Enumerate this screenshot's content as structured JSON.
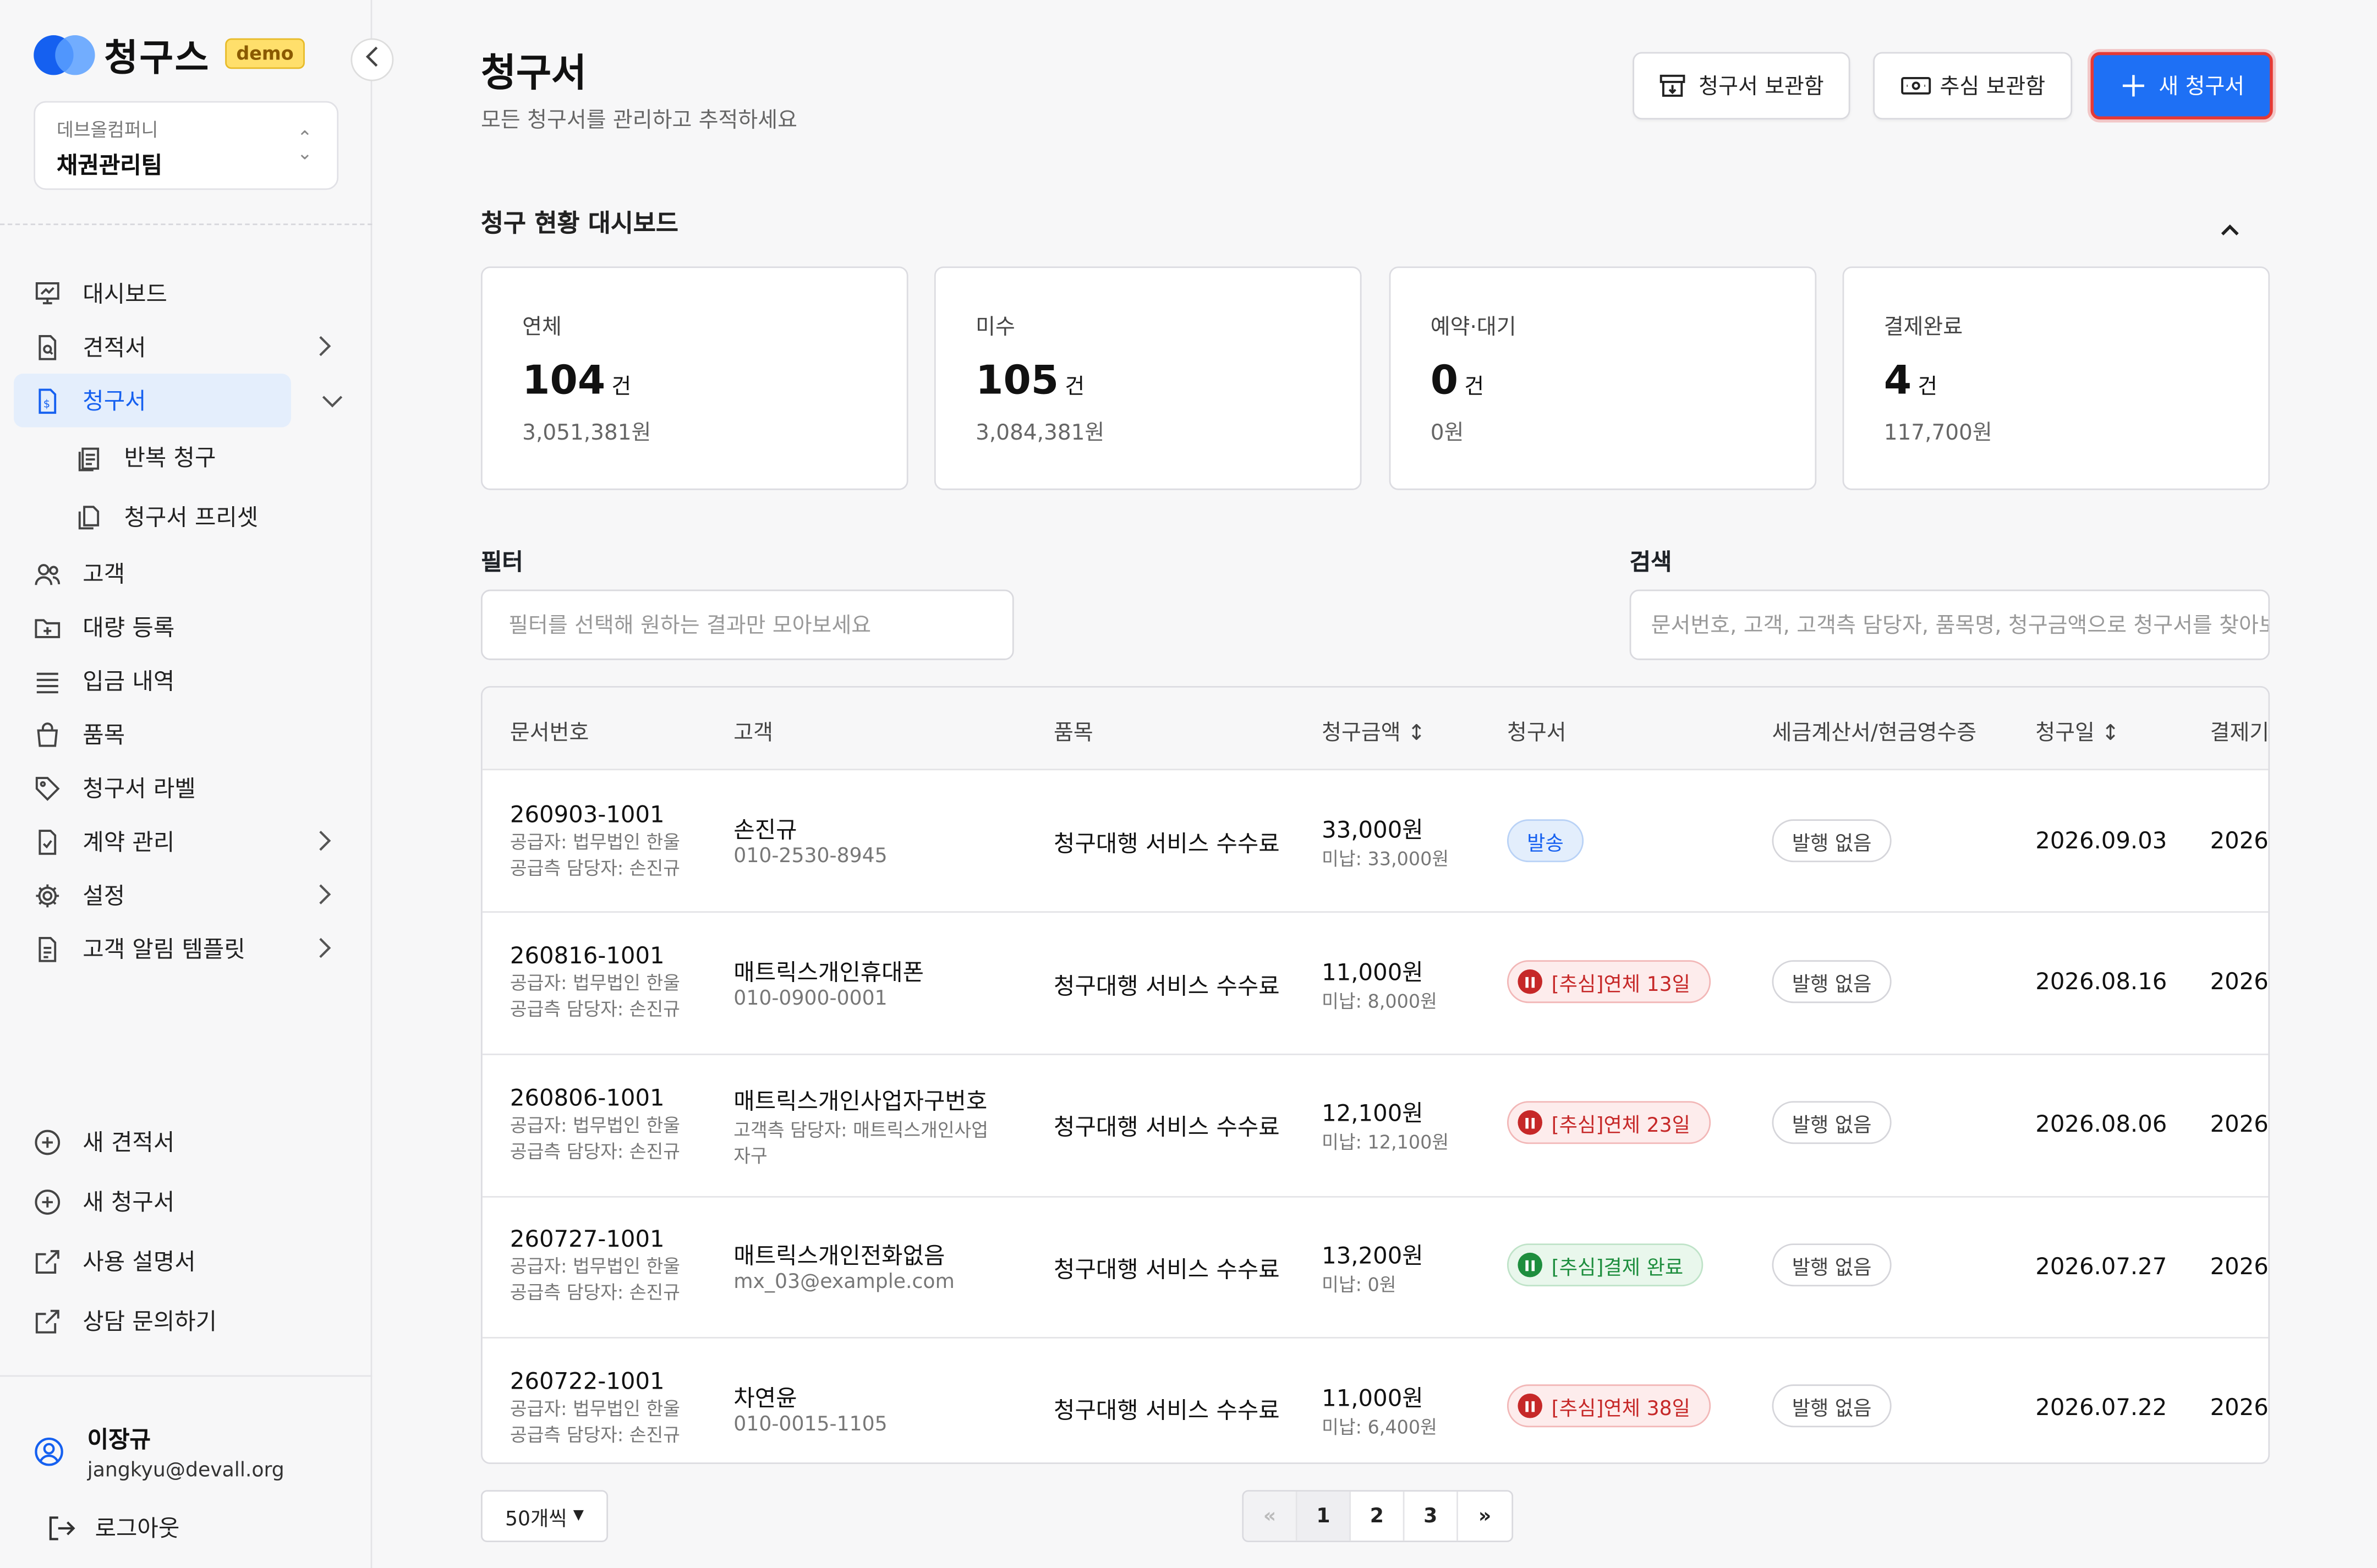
{
  "brand": {
    "name": "청구스",
    "badge": "demo"
  },
  "org": {
    "company": "데브올컴퍼니",
    "team": "채권관리팀"
  },
  "nav": {
    "items": [
      {
        "label": "대시보드",
        "icon": "dashboard-icon"
      },
      {
        "label": "견적서",
        "icon": "quote-doc-icon"
      },
      {
        "label": "청구서",
        "icon": "invoice-doc-icon"
      },
      {
        "label": "반복 청구",
        "icon": "recurring-icon"
      },
      {
        "label": "청구서 프리셋",
        "icon": "preset-icon"
      },
      {
        "label": "고객",
        "icon": "customers-icon"
      },
      {
        "label": "대량 등록",
        "icon": "bulk-upload-icon"
      },
      {
        "label": "입금 내역",
        "icon": "deposit-list-icon"
      },
      {
        "label": "품목",
        "icon": "bag-icon"
      },
      {
        "label": "청구서 라벨",
        "icon": "tag-icon"
      },
      {
        "label": "계약 관리",
        "icon": "contract-icon"
      },
      {
        "label": "설정",
        "icon": "gear-icon"
      },
      {
        "label": "고객 알림 템플릿",
        "icon": "template-icon"
      }
    ],
    "bottom": [
      {
        "label": "새 견적서",
        "icon": "plus-circle-icon"
      },
      {
        "label": "새 청구서",
        "icon": "plus-circle-icon"
      },
      {
        "label": "사용 설명서",
        "icon": "external-link-icon"
      },
      {
        "label": "상담 문의하기",
        "icon": "external-link-icon"
      }
    ]
  },
  "user": {
    "name": "이장규",
    "email": "jangkyu@devall.org",
    "logout": "로그아웃"
  },
  "header": {
    "title": "청구서",
    "subtitle": "모든 청구서를 관리하고 추적하세요",
    "archive_btn": "청구서 보관함",
    "collect_btn": "추심 보관함",
    "new_btn": "새 청구서"
  },
  "dashboard": {
    "title": "청구 현황 대시보드",
    "cards": [
      {
        "label": "연체",
        "count": "104",
        "unit": "건",
        "amount": "3,051,381원"
      },
      {
        "label": "미수",
        "count": "105",
        "unit": "건",
        "amount": "3,084,381원"
      },
      {
        "label": "예약·대기",
        "count": "0",
        "unit": "건",
        "amount": "0원"
      },
      {
        "label": "결제완료",
        "count": "4",
        "unit": "건",
        "amount": "117,700원"
      }
    ]
  },
  "filter": {
    "label": "필터",
    "placeholder": "필터를 선택해 원하는 결과만 모아보세요"
  },
  "search": {
    "label": "검색",
    "placeholder": "문서번호, 고객, 고객측 담당자, 품목명, 청구금액으로 청구서를 찾아보세요"
  },
  "table": {
    "headers": [
      "문서번호",
      "고객",
      "품목",
      "청구금액 ↕",
      "청구서",
      "세금계산서/현금영수증",
      "청구일 ↕",
      "결제기"
    ],
    "rows": [
      {
        "doc": "260903-1001",
        "supplier": "공급자: 법무법인 한울",
        "manager": "공급측 담당자: 손진규",
        "customer": "손진규",
        "contact": "010-2530-8945",
        "contact2": "",
        "item": "청구대행 서비스 수수료",
        "amount": "33,000원",
        "unpaid": "미납: 33,000원",
        "status": "발송",
        "status_type": "sent",
        "tax": "발행 없음",
        "date": "2026.09.03",
        "due": "2026."
      },
      {
        "doc": "260816-1001",
        "supplier": "공급자: 법무법인 한울",
        "manager": "공급측 담당자: 손진규",
        "customer": "매트릭스개인휴대폰",
        "contact": "010-0900-0001",
        "contact2": "",
        "item": "청구대행 서비스 수수료",
        "amount": "11,000원",
        "unpaid": "미납: 8,000원",
        "status": "[추심]연체 13일",
        "status_type": "red",
        "tax": "발행 없음",
        "date": "2026.08.16",
        "due": "2026."
      },
      {
        "doc": "260806-1001",
        "supplier": "공급자: 법무법인 한울",
        "manager": "공급측 담당자: 손진규",
        "customer": "매트릭스개인사업자구번호",
        "contact": "고객측 담당자: 매트릭스개인사업",
        "contact2": "자구",
        "item": "청구대행 서비스 수수료",
        "amount": "12,100원",
        "unpaid": "미납: 12,100원",
        "status": "[추심]연체 23일",
        "status_type": "red",
        "tax": "발행 없음",
        "date": "2026.08.06",
        "due": "2026."
      },
      {
        "doc": "260727-1001",
        "supplier": "공급자: 법무법인 한울",
        "manager": "공급측 담당자: 손진규",
        "customer": "매트릭스개인전화없음",
        "contact": "mx_03@example.com",
        "contact2": "",
        "item": "청구대행 서비스 수수료",
        "amount": "13,200원",
        "unpaid": "미납: 0원",
        "status": "[추심]결제 완료",
        "status_type": "green",
        "tax": "발행 없음",
        "date": "2026.07.27",
        "due": "2026."
      },
      {
        "doc": "260722-1001",
        "supplier": "공급자: 법무법인 한울",
        "manager": "공급측 담당자: 손진규",
        "customer": "차연윤",
        "contact": "010-0015-1105",
        "contact2": "",
        "item": "청구대행 서비스 수수료",
        "amount": "11,000원",
        "unpaid": "미납: 6,400원",
        "status": "[추심]연체 38일",
        "status_type": "red",
        "tax": "발행 없음",
        "date": "2026.07.22",
        "due": "2026."
      }
    ]
  },
  "pagination": {
    "per_page": "50개씩",
    "pages": [
      "«",
      "1",
      "2",
      "3",
      "»"
    ],
    "current": "1"
  },
  "colors": {
    "accent": "#1e70f5",
    "danger": "#c62828",
    "success": "#1e8e3e"
  }
}
